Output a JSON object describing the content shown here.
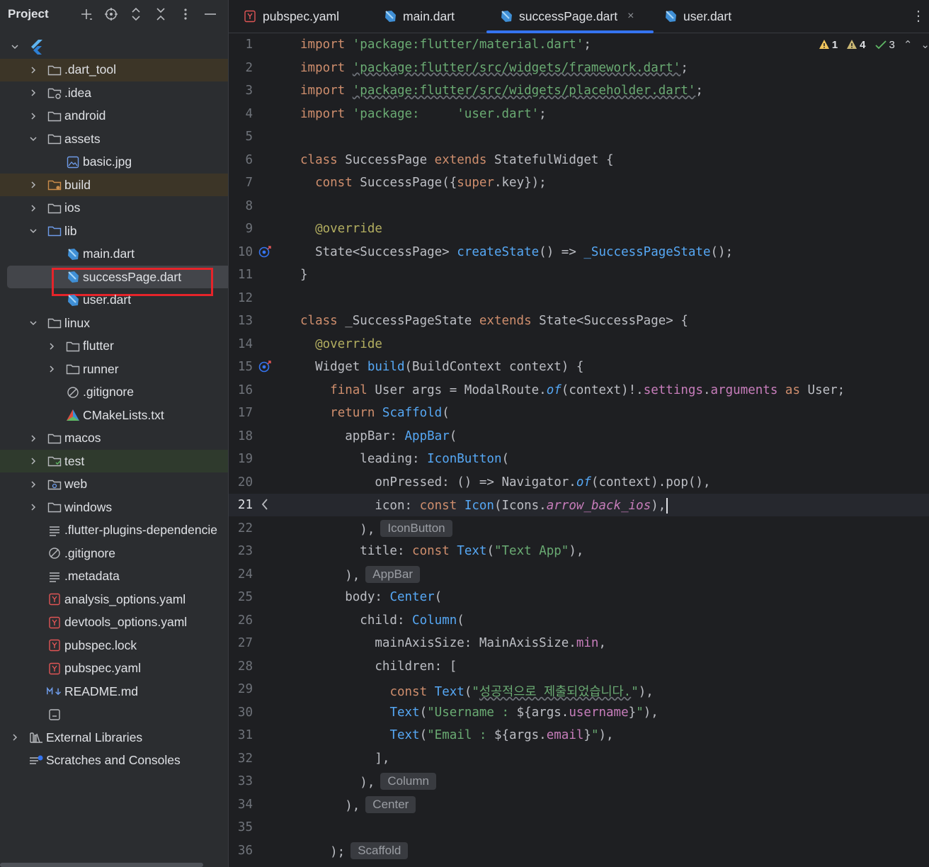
{
  "sidebar": {
    "title": "Project",
    "tree": [
      {
        "label": "",
        "depth": 0,
        "arrow": "down",
        "icon": "flutter-logo-icon"
      },
      {
        "label": ".dart_tool",
        "depth": 1,
        "arrow": "right",
        "icon": "folder-icon",
        "hl": "amber"
      },
      {
        "label": ".idea",
        "depth": 1,
        "arrow": "right",
        "icon": "folder-settings-icon"
      },
      {
        "label": "android",
        "depth": 1,
        "arrow": "right",
        "icon": "folder-icon"
      },
      {
        "label": "assets",
        "depth": 1,
        "arrow": "down",
        "icon": "folder-icon"
      },
      {
        "label": "basic.jpg",
        "depth": 2,
        "arrow": "",
        "icon": "image-file-icon"
      },
      {
        "label": "build",
        "depth": 1,
        "arrow": "right",
        "icon": "folder-excluded-icon",
        "hl": "amber"
      },
      {
        "label": "ios",
        "depth": 1,
        "arrow": "right",
        "icon": "folder-icon"
      },
      {
        "label": "lib",
        "depth": 1,
        "arrow": "down",
        "icon": "folder-source-icon"
      },
      {
        "label": "main.dart",
        "depth": 2,
        "arrow": "",
        "icon": "dart-file-icon"
      },
      {
        "label": "successPage.dart",
        "depth": 2,
        "arrow": "",
        "icon": "dart-file-icon",
        "selected": true
      },
      {
        "label": "user.dart",
        "depth": 2,
        "arrow": "",
        "icon": "dart-file-icon"
      },
      {
        "label": "linux",
        "depth": 1,
        "arrow": "down",
        "icon": "folder-icon"
      },
      {
        "label": "flutter",
        "depth": 2,
        "arrow": "right",
        "icon": "folder-icon"
      },
      {
        "label": "runner",
        "depth": 2,
        "arrow": "right",
        "icon": "folder-icon"
      },
      {
        "label": ".gitignore",
        "depth": 2,
        "arrow": "",
        "icon": "ignore-file-icon"
      },
      {
        "label": "CMakeLists.txt",
        "depth": 2,
        "arrow": "",
        "icon": "cmake-file-icon"
      },
      {
        "label": "macos",
        "depth": 1,
        "arrow": "right",
        "icon": "folder-icon"
      },
      {
        "label": "test",
        "depth": 1,
        "arrow": "right",
        "icon": "folder-test-icon",
        "hl": "green"
      },
      {
        "label": "web",
        "depth": 1,
        "arrow": "right",
        "icon": "folder-web-icon"
      },
      {
        "label": "windows",
        "depth": 1,
        "arrow": "right",
        "icon": "folder-icon"
      },
      {
        "label": ".flutter-plugins-dependencie",
        "depth": 1,
        "arrow": "",
        "icon": "text-file-icon"
      },
      {
        "label": ".gitignore",
        "depth": 1,
        "arrow": "",
        "icon": "ignore-file-icon"
      },
      {
        "label": ".metadata",
        "depth": 1,
        "arrow": "",
        "icon": "text-file-icon"
      },
      {
        "label": "analysis_options.yaml",
        "depth": 1,
        "arrow": "",
        "icon": "yaml-file-icon"
      },
      {
        "label": "devtools_options.yaml",
        "depth": 1,
        "arrow": "",
        "icon": "yaml-file-icon"
      },
      {
        "label": "pubspec.lock",
        "depth": 1,
        "arrow": "",
        "icon": "yaml-file-icon"
      },
      {
        "label": "pubspec.yaml",
        "depth": 1,
        "arrow": "",
        "icon": "yaml-file-icon"
      },
      {
        "label": "README.md",
        "depth": 1,
        "arrow": "",
        "icon": "markdown-file-icon"
      },
      {
        "label": "",
        "depth": 1,
        "arrow": "",
        "icon": "module-file-icon"
      },
      {
        "label": "External Libraries",
        "depth": 0,
        "arrow": "right",
        "icon": "library-icon"
      },
      {
        "label": "Scratches and Consoles",
        "depth": 0,
        "arrow": "",
        "icon": "scratches-icon"
      }
    ]
  },
  "tabs": [
    {
      "label": "pubspec.yaml",
      "icon": "yaml-file-icon"
    },
    {
      "label": "main.dart",
      "icon": "dart-file-icon"
    },
    {
      "label": "successPage.dart",
      "icon": "dart-file-icon",
      "active": true,
      "closable": true
    },
    {
      "label": "user.dart",
      "icon": "dart-file-icon"
    }
  ],
  "inspections": {
    "errors": "1",
    "warnings": "4",
    "ok": "3"
  },
  "colors": {
    "accent": "#3574f0",
    "keyword": "#cf8e6d",
    "string": "#6aab73",
    "function": "#56a8f5",
    "property": "#c77dbb",
    "annotation": "#b3ae60",
    "selection_box": "#e5242a"
  },
  "current_line": 21,
  "code": [
    [
      [
        "k",
        "import"
      ],
      [
        "t",
        " "
      ],
      [
        "s",
        "'package:flutter/material.dart'"
      ],
      [
        "t",
        ";"
      ]
    ],
    [
      [
        "k",
        "import"
      ],
      [
        "t",
        " "
      ],
      [
        "su",
        "'package:flutter/src/widgets/framework.dart'"
      ],
      [
        "t",
        ";"
      ]
    ],
    [
      [
        "k",
        "import"
      ],
      [
        "t",
        " "
      ],
      [
        "su",
        "'package:flutter/src/widgets/placeholder.dart'"
      ],
      [
        "t",
        ";"
      ]
    ],
    [
      [
        "k",
        "import"
      ],
      [
        "t",
        " "
      ],
      [
        "s",
        "'package:     'user.dart'"
      ],
      [
        "t",
        ";"
      ]
    ],
    [],
    [
      [
        "k",
        "class"
      ],
      [
        "t",
        " SuccessPage "
      ],
      [
        "k",
        "extends"
      ],
      [
        "t",
        " StatefulWidget {"
      ]
    ],
    [
      [
        "t",
        "  "
      ],
      [
        "k",
        "const"
      ],
      [
        "t",
        " SuccessPage({"
      ],
      [
        "k",
        "super"
      ],
      [
        "t",
        ".key});"
      ]
    ],
    [],
    [
      [
        "t",
        "  "
      ],
      [
        "a",
        "@override"
      ]
    ],
    [
      [
        "t",
        "  State<SuccessPage> "
      ],
      [
        "f",
        "createState"
      ],
      [
        "t",
        "() => "
      ],
      [
        "f",
        "_SuccessPageState"
      ],
      [
        "t",
        "();"
      ]
    ],
    [
      [
        "t",
        "}"
      ]
    ],
    [],
    [
      [
        "k",
        "class"
      ],
      [
        "t",
        " _SuccessPageState "
      ],
      [
        "k",
        "extends"
      ],
      [
        "t",
        " State<SuccessPage> {"
      ]
    ],
    [
      [
        "t",
        "  "
      ],
      [
        "a",
        "@override"
      ]
    ],
    [
      [
        "t",
        "  Widget "
      ],
      [
        "f",
        "build"
      ],
      [
        "t",
        "(BuildContext context) {"
      ]
    ],
    [
      [
        "t",
        "    "
      ],
      [
        "k",
        "final"
      ],
      [
        "t",
        " User args = ModalRoute."
      ],
      [
        "fi",
        "of"
      ],
      [
        "t",
        "(context)!."
      ],
      [
        "p",
        "settings"
      ],
      [
        "t",
        "."
      ],
      [
        "p",
        "arguments"
      ],
      [
        "t",
        " "
      ],
      [
        "k",
        "as"
      ],
      [
        "t",
        " User;"
      ]
    ],
    [
      [
        "t",
        "    "
      ],
      [
        "k",
        "return"
      ],
      [
        "t",
        " "
      ],
      [
        "f",
        "Scaffold"
      ],
      [
        "t",
        "("
      ]
    ],
    [
      [
        "t",
        "      appBar: "
      ],
      [
        "f",
        "AppBar"
      ],
      [
        "t",
        "("
      ]
    ],
    [
      [
        "t",
        "        leading: "
      ],
      [
        "f",
        "IconButton"
      ],
      [
        "t",
        "("
      ]
    ],
    [
      [
        "t",
        "          onPressed: () => Navigator."
      ],
      [
        "fi",
        "of"
      ],
      [
        "t",
        "(context).pop(),"
      ]
    ],
    [
      [
        "t",
        "          icon: "
      ],
      [
        "k",
        "const"
      ],
      [
        "t",
        " "
      ],
      [
        "f",
        "Icon"
      ],
      [
        "t",
        "(Icons."
      ],
      [
        "pi",
        "arrow_back_ios"
      ],
      [
        "t",
        "),"
      ],
      [
        "caret",
        ""
      ]
    ],
    [
      [
        "t",
        "        ),"
      ],
      [
        "h",
        "IconButton"
      ]
    ],
    [
      [
        "t",
        "        title: "
      ],
      [
        "k",
        "const"
      ],
      [
        "t",
        " "
      ],
      [
        "f",
        "Text"
      ],
      [
        "t",
        "("
      ],
      [
        "s",
        "\"Text App\""
      ],
      [
        "t",
        "),"
      ]
    ],
    [
      [
        "t",
        "      ),"
      ],
      [
        "h",
        "AppBar"
      ]
    ],
    [
      [
        "t",
        "      body: "
      ],
      [
        "f",
        "Center"
      ],
      [
        "t",
        "("
      ]
    ],
    [
      [
        "t",
        "        child: "
      ],
      [
        "f",
        "Column"
      ],
      [
        "t",
        "("
      ]
    ],
    [
      [
        "t",
        "          mainAxisSize: MainAxisSize."
      ],
      [
        "p",
        "min"
      ],
      [
        "t",
        ","
      ]
    ],
    [
      [
        "t",
        "          children: ["
      ]
    ],
    [
      [
        "t",
        "            "
      ],
      [
        "k",
        "const"
      ],
      [
        "t",
        " "
      ],
      [
        "f",
        "Text"
      ],
      [
        "t",
        "("
      ],
      [
        "s",
        "\""
      ],
      [
        "su",
        "성공적으로 제출되었습니다."
      ],
      [
        "s",
        "\""
      ],
      [
        "t",
        "),"
      ]
    ],
    [
      [
        "t",
        "            "
      ],
      [
        "f",
        "Text"
      ],
      [
        "t",
        "("
      ],
      [
        "s",
        "\"Username : "
      ],
      [
        "t",
        "${args."
      ],
      [
        "p",
        "username"
      ],
      [
        "t",
        "}"
      ],
      [
        "s",
        "\""
      ],
      [
        "t",
        "),"
      ]
    ],
    [
      [
        "t",
        "            "
      ],
      [
        "f",
        "Text"
      ],
      [
        "t",
        "("
      ],
      [
        "s",
        "\"Email : "
      ],
      [
        "t",
        "${args."
      ],
      [
        "p",
        "email"
      ],
      [
        "t",
        "}"
      ],
      [
        "s",
        "\""
      ],
      [
        "t",
        "),"
      ]
    ],
    [
      [
        "t",
        "          ],"
      ]
    ],
    [
      [
        "t",
        "        ),"
      ],
      [
        "h",
        "Column"
      ]
    ],
    [
      [
        "t",
        "      ),"
      ],
      [
        "h",
        "Center"
      ]
    ],
    [],
    [
      [
        "t",
        "    );"
      ],
      [
        "h",
        "Scaffold"
      ]
    ]
  ]
}
